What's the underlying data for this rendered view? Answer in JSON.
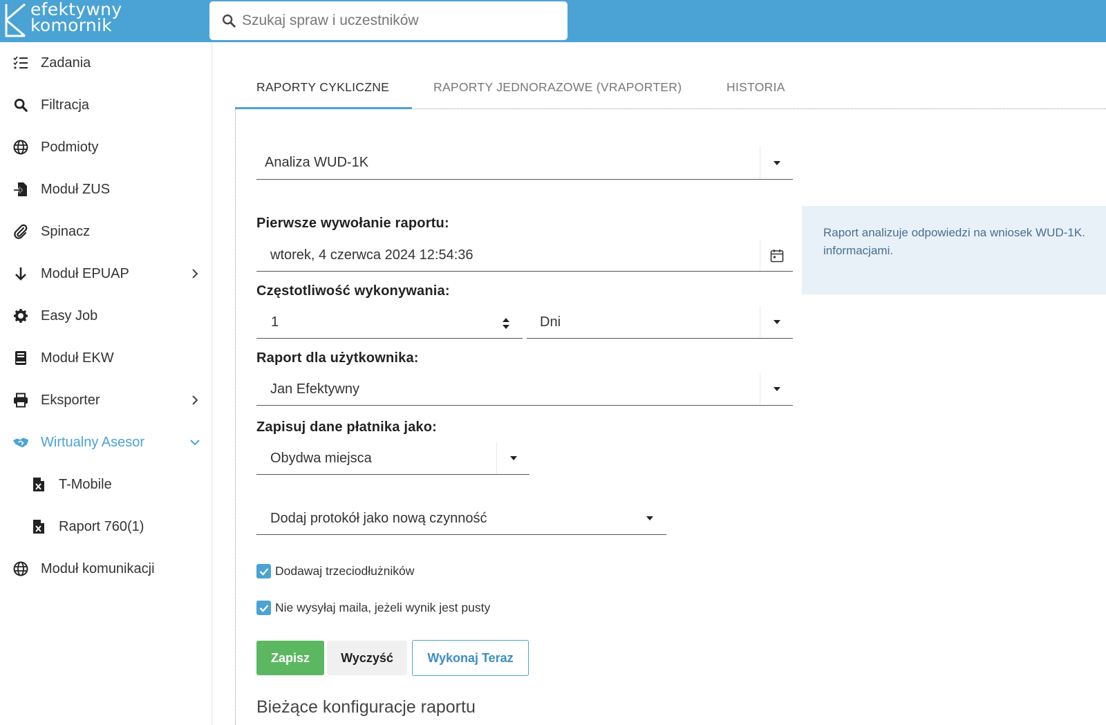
{
  "app": {
    "logo_line1": "efektywny",
    "logo_line2": "komornik",
    "brand_color": "#4aa3d4"
  },
  "search": {
    "placeholder": "Szukaj spraw i uczestników",
    "icon": "search-icon"
  },
  "sidebar": {
    "items": [
      {
        "label": "Zadania",
        "icon": "task-list-icon"
      },
      {
        "label": "Filtracja",
        "icon": "search-icon"
      },
      {
        "label": "Podmioty",
        "icon": "globe-icon"
      },
      {
        "label": "Moduł ZUS",
        "icon": "file-import-icon"
      },
      {
        "label": "Spinacz",
        "icon": "paperclip-icon"
      },
      {
        "label": "Moduł EPUAP",
        "icon": "arrow-down-icon"
      },
      {
        "label": "Easy Job",
        "icon": "gear-icon"
      },
      {
        "label": "Moduł EKW",
        "icon": "book-icon"
      },
      {
        "label": "Eksporter",
        "icon": "printer-icon"
      },
      {
        "label": "Wirtualny Asesor",
        "icon": "handshake-icon"
      },
      {
        "label": "T-Mobile",
        "icon": "excel-file-icon"
      },
      {
        "label": "Raport 760(1)",
        "icon": "excel-file-icon"
      },
      {
        "label": "Moduł komunikacji",
        "icon": "globe-icon"
      }
    ]
  },
  "tabs": [
    {
      "label": "RAPORTY CYKLICZNE",
      "active": true
    },
    {
      "label": "RAPORTY JEDNORAZOWE (VRAPORTER)",
      "active": false
    },
    {
      "label": "HISTORIA",
      "active": false
    }
  ],
  "form": {
    "report_type": "Analiza WUD-1K",
    "first_call_label": "Pierwsze wywołanie raportu:",
    "first_call_value": "wtorek, 4 czerwca 2024 12:54:36",
    "frequency_label": "Częstotliwość wykonywania:",
    "frequency_value": "1",
    "frequency_unit": "Dni",
    "user_label": "Raport dla użytkownika:",
    "user_value": "Jan Efektywny",
    "payer_label": "Zapisuj dane płatnika jako:",
    "payer_value": "Obydwa miejsca",
    "protocol_value": "Dodaj protokół jako nową czynność",
    "checkbox1_label": "Dodawaj trzeciodłużników",
    "checkbox1_checked": true,
    "checkbox2_label": "Nie wysyłaj maila, jeżeli wynik jest pusty",
    "checkbox2_checked": true
  },
  "info": {
    "text": "Raport analizuje odpowiedzi na wniosek WUD-1K. informacjami."
  },
  "buttons": {
    "save": "Zapisz",
    "clear": "Wyczyść",
    "run": "Wykonaj Teraz"
  },
  "section": {
    "title": "Bieżące konfiguracje raportu"
  }
}
